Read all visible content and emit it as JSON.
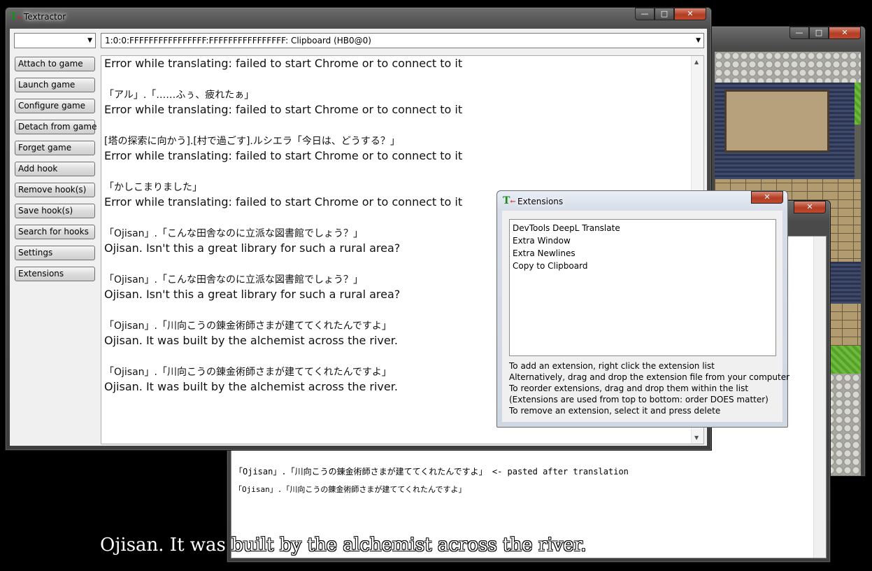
{
  "main_window": {
    "title": "Textractor",
    "process_combo_value": "",
    "thread_combo_value": "1:0:0:FFFFFFFFFFFFFFFF:FFFFFFFFFFFFFFFF: Clipboard (HB0@0)",
    "buttons": [
      {
        "label": "Attach to game"
      },
      {
        "label": "Launch game"
      },
      {
        "label": "Configure game"
      },
      {
        "label": "Detach from game"
      },
      {
        "label": "Forget game"
      },
      {
        "label": "Add hook"
      },
      {
        "label": "Remove hook(s)"
      },
      {
        "label": "Save hook(s)"
      },
      {
        "label": "Search for hooks"
      },
      {
        "label": "Settings"
      },
      {
        "label": "Extensions"
      }
    ],
    "text_lines": [
      "Error while translating: failed to start Chrome or to connect to it",
      "",
      "「アル」.「……ふぅ、疲れたぁ」",
      "Error while translating: failed to start Chrome or to connect to it",
      "",
      "[塔の探索に向かう].[村で過ごす].ルシエラ「今日は、どうする？」",
      "Error while translating: failed to start Chrome or to connect to it",
      "",
      "「かしこまりました」",
      "Error while translating: failed to start Chrome or to connect to it",
      "",
      "「Ojisan」.「こんな田舎なのに立派な図書館でしょう？」",
      "Ojisan. Isn't this a great library for such a rural area?",
      "",
      "「Ojisan」.「こんな田舎なのに立派な図書館でしょう？」",
      "Ojisan. Isn't this a great library for such a rural area?",
      "",
      "「Ojisan」.「川向こうの錬金術師さまが建ててくれたんですよ」",
      "Ojisan. It was built by the alchemist across the river.",
      "",
      "「Ojisan」.「川向こうの錬金術師さまが建ててくれたんですよ」",
      "Ojisan. It was built by the alchemist across the river."
    ]
  },
  "extensions_dialog": {
    "title": "Extensions",
    "items": [
      "DevTools DeepL Translate",
      "Extra Window",
      "Extra Newlines",
      "Copy to Clipboard"
    ],
    "help_lines": [
      "To add an extension, right click the extension list",
      "Alternatively, drag and drop the extension file from your computer",
      "To reorder extensions, drag and drop them within the list",
      "(Extensions are used from top to bottom: order DOES matter)",
      "To remove an extension, select it and press delete"
    ]
  },
  "notepad": {
    "lines": [
      "「Ojisan」.「川向こうの錬金術師さまが建ててくれたんですよ」 <- pasted after translation",
      "「Ojisan」.「川向こうの錬金術師さまが建ててくれたんですよ」"
    ]
  },
  "subtitle": "Ojisan. It was built by the alchemist across the river.",
  "icons": {
    "minimize": "—",
    "maximize": "□",
    "close": "✕",
    "dropdown": "▼",
    "scroll_up": "▲",
    "scroll_down": "▼"
  }
}
